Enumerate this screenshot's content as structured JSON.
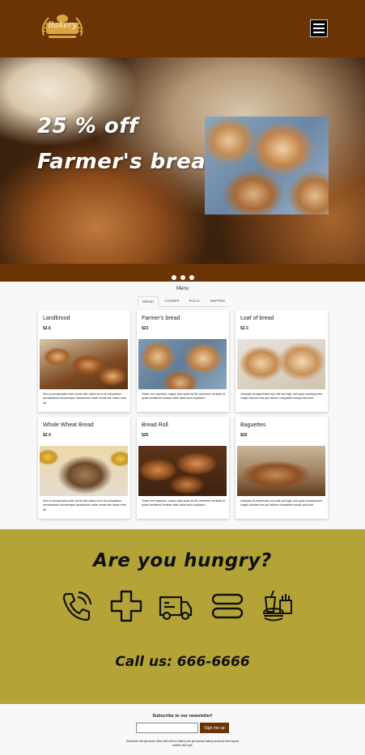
{
  "header": {
    "logo_text": "Bakery",
    "menu_button": "menu"
  },
  "hero": {
    "line1": "25 % off",
    "line2": "Farmer's bread !",
    "carousel_active_index": 1,
    "carousel_count": 3
  },
  "menu": {
    "title": "Menu",
    "tabs": [
      "BREAD",
      "COOKIES",
      "ROLLS",
      "MUFFINS"
    ],
    "active_tab": "BREAD",
    "cards": [
      {
        "name": "Landbrood",
        "price": "$2.6",
        "desc": "Sed ut perspiciatis unde omnis iste natus error sit voluptatem accusantium doloremque laudantium unde omnis iste natus error sit"
      },
      {
        "name": "Farmer's bread",
        "price": "$23",
        "desc": "Totam rem aperiam, eaque ipsa quae ab illo inventore veritatis et quasi architecto beatae vitae dicta sunt explicabo."
      },
      {
        "name": "Loaf of bread",
        "price": "$2.3",
        "desc": "Voluptas sit aspernatur aut odit aut fugit, sed quia consequuntur magni dolores eos qui ratione voluptatem sequi nesciunt."
      },
      {
        "name": "Whole Wheat Bread",
        "price": "$2.4",
        "desc": "Sed ut perspiciatis unde omnis iste natus error sit voluptatem accusantium doloremque laudantium unde omnis iste natus error sit"
      },
      {
        "name": "Bread Roll",
        "price": "$25",
        "desc": "Totam rem aperiam, eaque ipsa quae ab illo inventore veritatis et quasi architecto beatae vitae dicta sunt explicabo."
      },
      {
        "name": "Baguettes",
        "price": "$25",
        "desc": "Voluptas sit aspernatur aut odit aut fugit, sed quia consequuntur magni dolores eos qui ratione voluptatem sequi nesciunt."
      }
    ]
  },
  "hungry": {
    "title": "Are you hungry?",
    "icons": [
      "phone-icon",
      "plus-icon",
      "delivery-truck-icon",
      "equals-icon",
      "fast-food-icon"
    ],
    "call": "Call us: 666-6666"
  },
  "newsletter": {
    "title": "Subscribe to our newsletter!",
    "input_value": "",
    "input_placeholder": "",
    "button": "Sign me up",
    "note": "Subscribe and get some offers that all from bakery and get special bakery products that regular readers don't get."
  },
  "colors": {
    "brand_brown": "#6b3405",
    "hungry_bg": "#b4a438"
  }
}
